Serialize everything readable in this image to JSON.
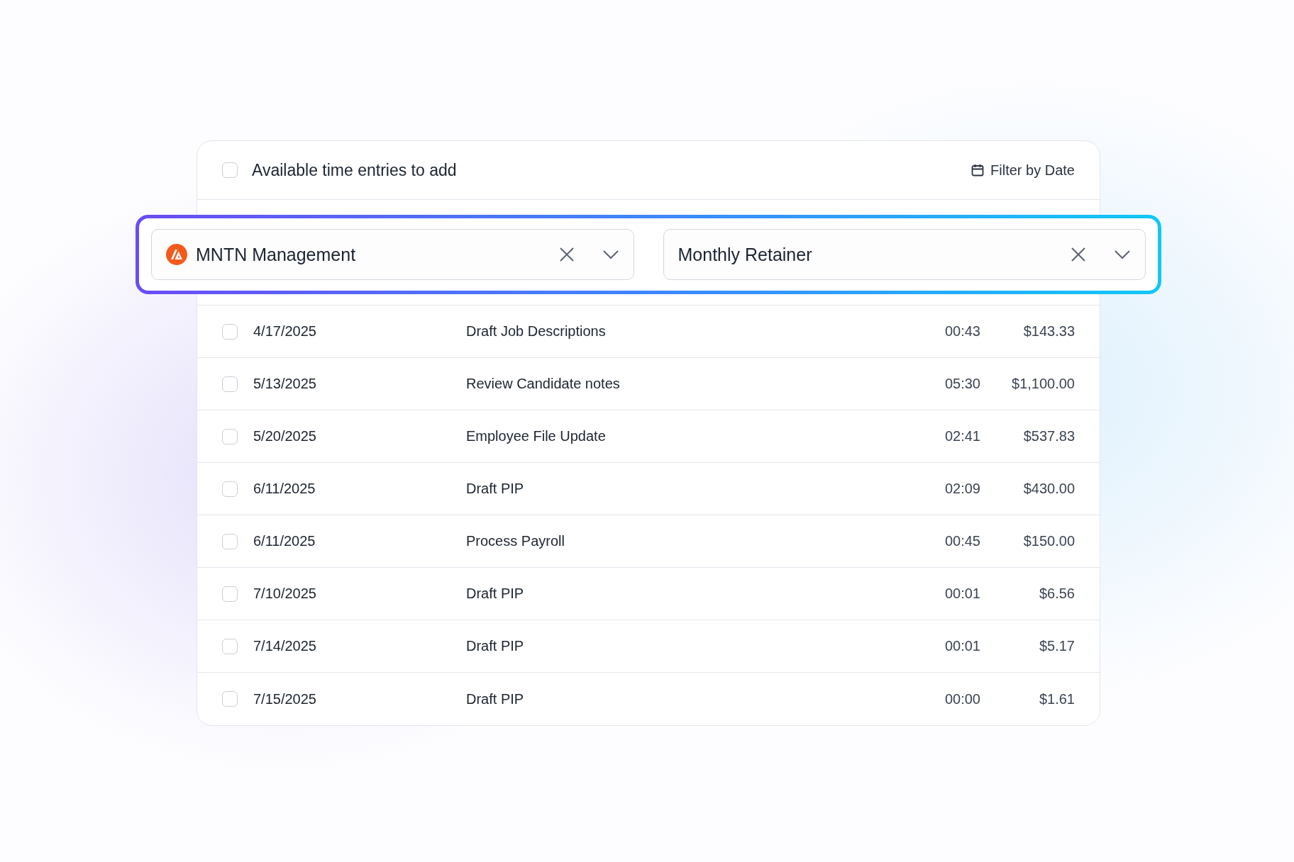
{
  "header": {
    "select_all": {
      "label": "Available time entries to add",
      "checked": false
    },
    "filter_button": {
      "label": "Filter by Date"
    }
  },
  "filters": [
    {
      "kind": "client",
      "value": "MNTN Management"
    },
    {
      "kind": "plain",
      "value": "Monthly Retainer"
    }
  ],
  "rows": [
    {
      "checked": false,
      "date": "4/17/2025",
      "description": "Draft Job Descriptions",
      "duration": "00:43",
      "amount": "$143.33"
    },
    {
      "checked": false,
      "date": "5/13/2025",
      "description": "Review Candidate notes",
      "duration": "05:30",
      "amount": "$1,100.00"
    },
    {
      "checked": false,
      "date": "5/20/2025",
      "description": "Employee File Update",
      "duration": "02:41",
      "amount": "$537.83"
    },
    {
      "checked": false,
      "date": "6/11/2025",
      "description": "Draft PIP",
      "duration": "02:09",
      "amount": "$430.00"
    },
    {
      "checked": false,
      "date": "6/11/2025",
      "description": "Process Payroll",
      "duration": "00:45",
      "amount": "$150.00"
    },
    {
      "checked": false,
      "date": "7/10/2025",
      "description": "Draft PIP",
      "duration": "00:01",
      "amount": "$6.56"
    },
    {
      "checked": false,
      "date": "7/14/2025",
      "description": "Draft PIP",
      "duration": "00:01",
      "amount": "$5.17"
    },
    {
      "checked": false,
      "date": "7/15/2025",
      "description": "Draft PIP",
      "duration": "00:00",
      "amount": "$1.61"
    }
  ]
}
